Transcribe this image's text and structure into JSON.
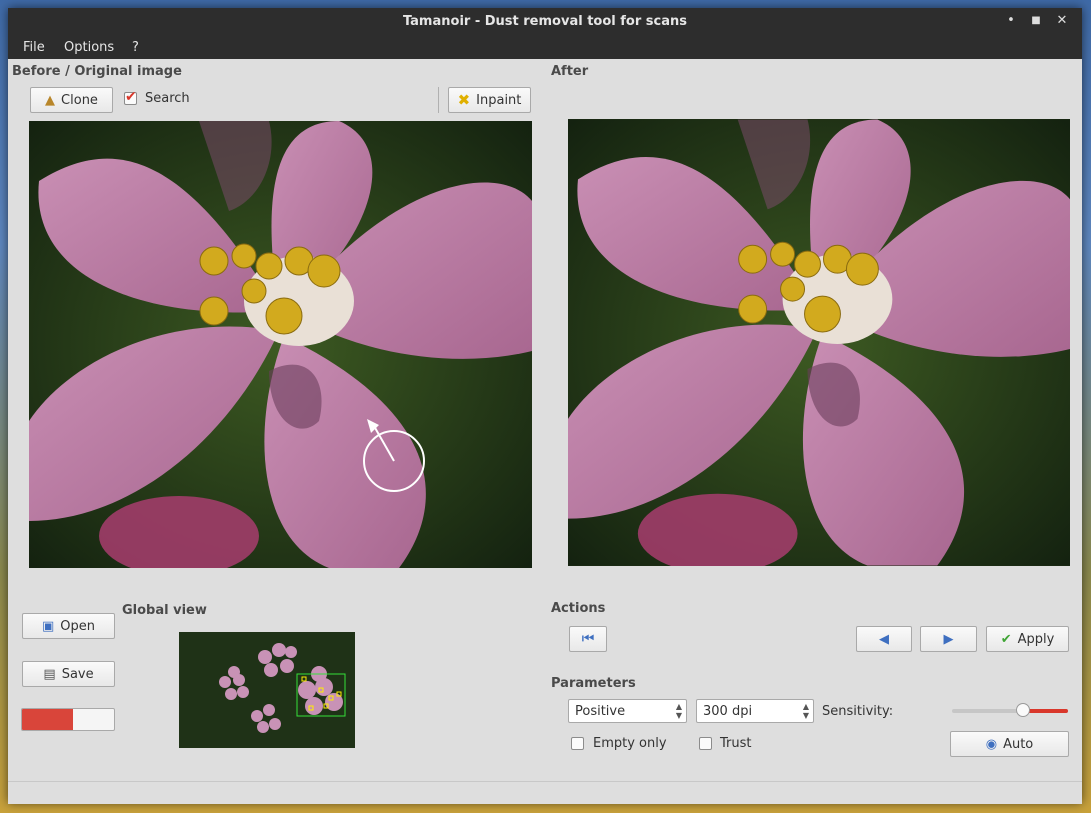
{
  "window": {
    "title": "Tamanoir - Dust removal tool for scans",
    "controls": {
      "minimize": "•",
      "maximize": "■",
      "close": "✕"
    }
  },
  "menu": [
    "File",
    "Options",
    "?"
  ],
  "before": {
    "title": "Before / Original image",
    "clone_label": "Clone",
    "search_label": "Search",
    "search_checked": true,
    "inpaint_label": "Inpaint"
  },
  "after": {
    "title": "After"
  },
  "left_panel": {
    "open_label": "Open",
    "save_label": "Save",
    "progress": 0.55,
    "global_view_title": "Global view"
  },
  "actions": {
    "title": "Actions",
    "apply_label": "Apply"
  },
  "parameters": {
    "title": "Parameters",
    "film_type": "Positive",
    "resolution": "300 dpi",
    "sensitivity_label": "Sensitivity:",
    "sensitivity": 0.61,
    "empty_only_label": "Empty only",
    "empty_only": false,
    "trust_label": "Trust",
    "trust": false,
    "auto_label": "Auto"
  },
  "colors": {
    "accent_red": "#d9372b",
    "apply_green": "#3fa535",
    "nav_blue": "#3e6fc0"
  }
}
